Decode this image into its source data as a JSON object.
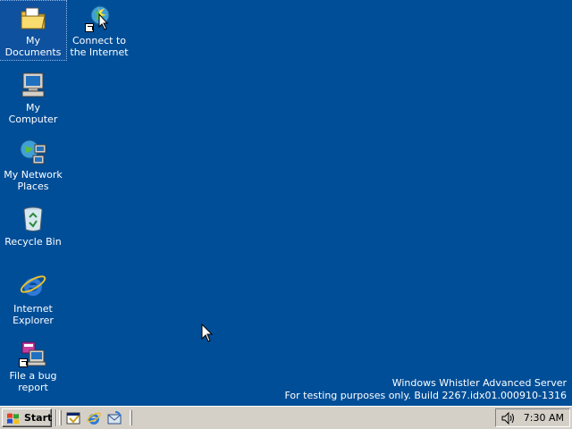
{
  "desktop": {
    "icons": [
      {
        "label": "My Documents"
      },
      {
        "label": "Connect to the Internet"
      },
      {
        "label": "My Computer"
      },
      {
        "label": "My Network Places"
      },
      {
        "label": "Recycle Bin"
      },
      {
        "label": "Internet Explorer"
      },
      {
        "label": "File a bug report"
      }
    ],
    "background_color": "#004e98"
  },
  "watermark": {
    "line1": "Windows Whistler Advanced Server",
    "line2": "For testing purposes only. Build 2267.idx01.000910-1316"
  },
  "taskbar": {
    "start_label": "Start",
    "quick_launch": [
      "show-desktop-icon",
      "internet-explorer-icon",
      "outlook-express-icon"
    ],
    "clock": "7:30 AM"
  }
}
